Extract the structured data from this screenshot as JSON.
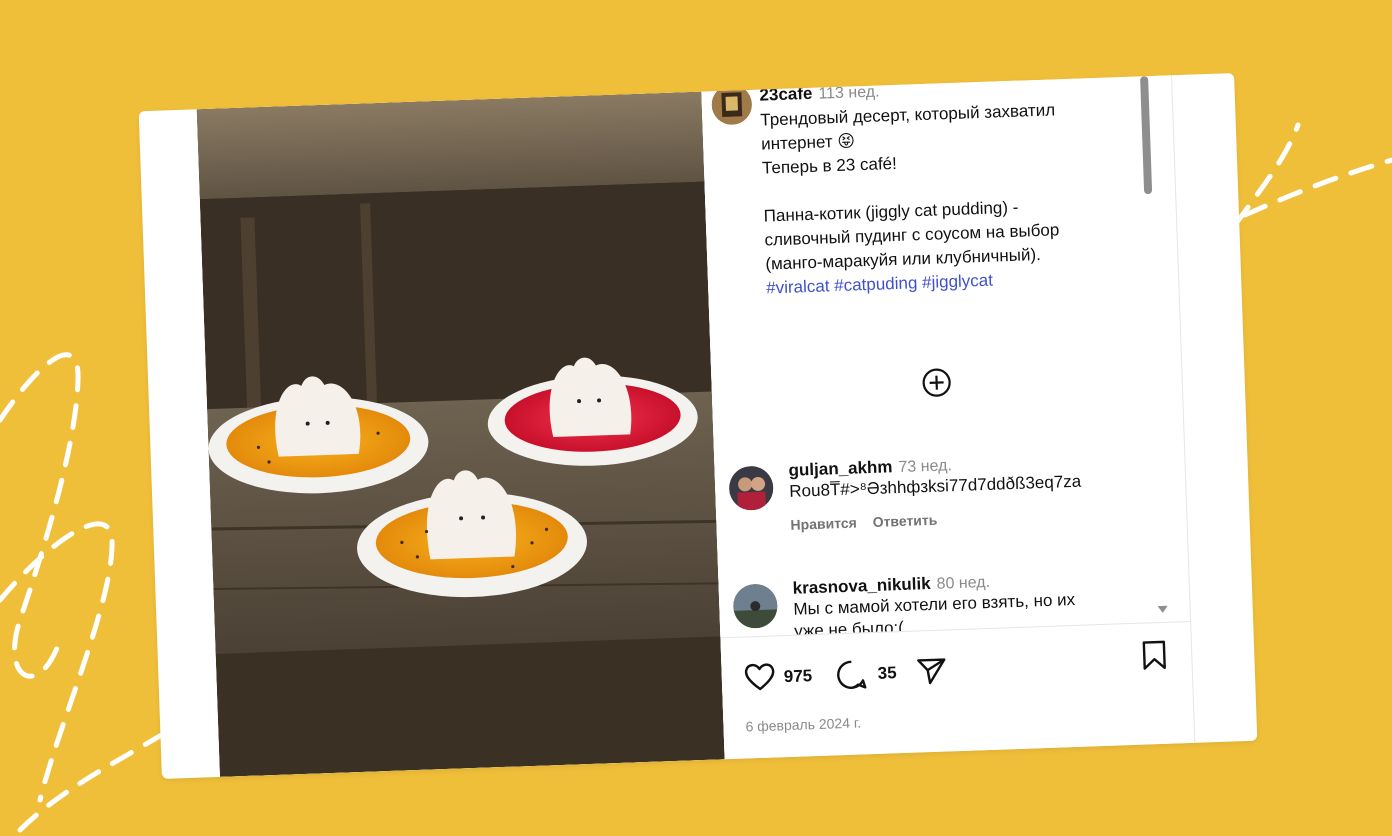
{
  "post": {
    "username": "23cafe",
    "time_ago": "113 нед.",
    "caption_line1": "Трендовый десерт, который захватил",
    "caption_line2": "интернет 😝",
    "caption_line3": "Теперь в 23 café!",
    "caption_line4": "Панна-котик (jiggly cat pudding) -",
    "caption_line5": "сливочный пудинг с соусом на выбор",
    "caption_line6": "(манго-маракуйя или клубничный).",
    "hashtags": "#viralcat #catpuding #jigglycat"
  },
  "comments": [
    {
      "username": "guljan_akhm",
      "time_ago": "73 нед.",
      "text": "Rou8T̅#>⁸Əзhhфзksi77d7ddðß3eq7za",
      "like_label": "Нравится",
      "reply_label": "Ответить"
    },
    {
      "username": "krasnova_nikulik",
      "time_ago": "80 нед.",
      "text_line1": "Мы с мамой хотели его взять, но их",
      "text_line2": "уже не было:("
    }
  ],
  "stats": {
    "likes": "975",
    "comments": "35"
  },
  "date": "6 февраль 2024 г.",
  "icons": {
    "like": "heart-icon",
    "comment": "comment-bubble-icon",
    "share": "send-icon",
    "save": "bookmark-icon",
    "add": "plus-circle-icon"
  },
  "colors": {
    "background": "#f0bf3a",
    "hashtag": "#3f51c9",
    "muted": "#8a8a8a"
  }
}
